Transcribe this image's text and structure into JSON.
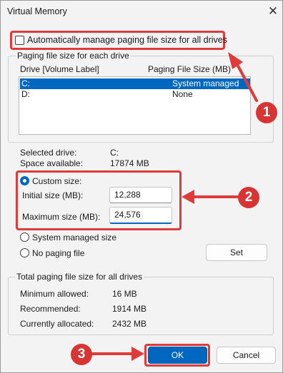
{
  "window": {
    "title": "Virtual Memory",
    "close_glyph": "✕"
  },
  "auto_manage": {
    "label": "Automatically manage paging file size for all drives",
    "checked": false
  },
  "drives_group": {
    "legend": "Paging file size for each drive",
    "headers": {
      "drive": "Drive  [Volume Label]",
      "size": "Paging File Size (MB)"
    },
    "rows": [
      {
        "drive": "C:",
        "size": "System managed",
        "selected": true
      },
      {
        "drive": "D:",
        "size": "None",
        "selected": false
      }
    ]
  },
  "selected_drive": {
    "label": "Selected drive:",
    "value": "C:"
  },
  "space_available": {
    "label": "Space available:",
    "value": "17874 MB"
  },
  "custom_size": {
    "label": "Custom size:",
    "selected": true
  },
  "initial_size": {
    "label": "Initial size (MB):",
    "value": "12,288"
  },
  "maximum_size": {
    "label": "Maximum size (MB):",
    "value": "24,576"
  },
  "system_managed": {
    "label": "System managed size"
  },
  "no_paging": {
    "label": "No paging file"
  },
  "set_button": {
    "label": "Set"
  },
  "totals_group": {
    "legend": "Total paging file size for all drives",
    "minimum": {
      "label": "Minimum allowed:",
      "value": "16 MB"
    },
    "recommended": {
      "label": "Recommended:",
      "value": "1914 MB"
    },
    "allocated": {
      "label": "Currently allocated:",
      "value": "2432 MB"
    }
  },
  "ok_button": {
    "label": "OK"
  },
  "cancel_button": {
    "label": "Cancel"
  },
  "annotations": {
    "badge1": "1",
    "badge2": "2",
    "badge3": "3",
    "color": "#e03b3b"
  }
}
